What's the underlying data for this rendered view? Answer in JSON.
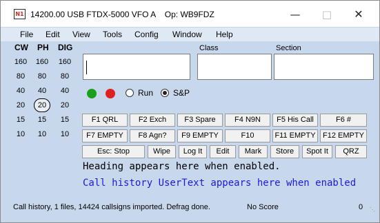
{
  "window": {
    "title": "14200.00 USB FTDX-5000 VFO A    Op: WB9FDZ",
    "logo_text": "N1"
  },
  "menu": [
    "File",
    "Edit",
    "View",
    "Tools",
    "Config",
    "Window",
    "Help"
  ],
  "bands": {
    "headers": [
      "CW",
      "PH",
      "DIG"
    ],
    "rows": [
      [
        "160",
        "160",
        "160"
      ],
      [
        "80",
        "80",
        "80"
      ],
      [
        "40",
        "40",
        "40"
      ],
      [
        "20",
        "20",
        "20"
      ],
      [
        "15",
        "15",
        "15"
      ],
      [
        "10",
        "10",
        "10"
      ]
    ],
    "selected": "PH 20"
  },
  "fields": {
    "call_label": "",
    "class_label": "Class",
    "section_label": "Section",
    "call_value": "",
    "class_value": "",
    "section_value": ""
  },
  "indicators": {
    "green": "#1aa01a",
    "red": "#e02020"
  },
  "mode_radio": {
    "run_label": "Run",
    "sp_label": "S&P",
    "selected": "S&P"
  },
  "fkeys_row1": [
    "F1 QRL",
    "F2 Exch",
    "F3 Spare",
    "F4 N9N",
    "F5 His Call",
    "F6 #"
  ],
  "fkeys_row2": [
    "F7 EMPTY",
    "F8 Agn?",
    "F9 EMPTY",
    "F10",
    "F11 EMPTY",
    "F12 EMPTY"
  ],
  "actions": [
    "Esc: Stop",
    "Wipe",
    "Log It",
    "Edit",
    "Mark",
    "Store",
    "Spot It",
    "QRZ"
  ],
  "heading_text": "Heading appears here when enabled.",
  "call_history_text": "Call history UserText appears here when enabled",
  "status": {
    "left": "Call history, 1 files, 14424 callsigns imported. Defrag done.",
    "score": "No Score",
    "count": "0"
  },
  "colors": {
    "window_bg": "#c8d8ec",
    "blue_text": "#1a1ad8"
  }
}
